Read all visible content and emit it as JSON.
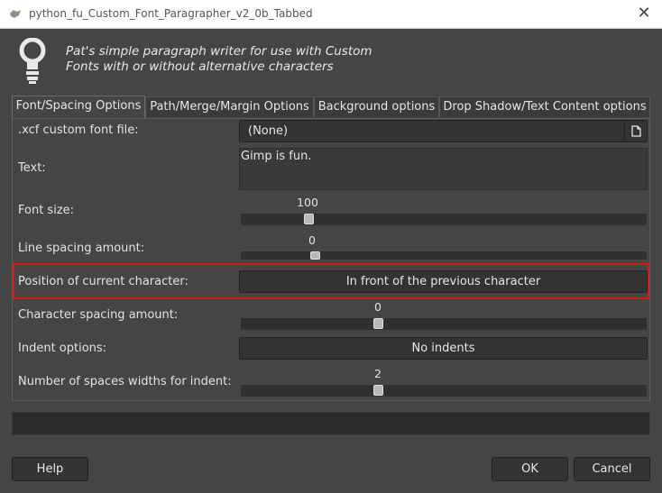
{
  "window": {
    "title": "python_fu_Custom_Font_Paragrapher_v2_0b_Tabbed"
  },
  "header": {
    "line1": "Pat's simple paragraph writer for use with Custom",
    "line2": "Fonts with or without alternative characters"
  },
  "tabs": [
    {
      "label": "Font/Spacing Options",
      "active": true
    },
    {
      "label": "Path/Merge/Margin Options",
      "active": false
    },
    {
      "label": "Background options",
      "active": false
    },
    {
      "label": "Drop Shadow/Text Content options",
      "active": false
    }
  ],
  "form": {
    "font_file": {
      "label": ".xcf custom font file:",
      "value": "(None)"
    },
    "text": {
      "label": "Text:",
      "value": "Gimp is fun."
    },
    "font_size": {
      "label": "Font size:",
      "value": "100",
      "fraction": 0.16
    },
    "line_spacing": {
      "label": "Line spacing amount:",
      "value": "0",
      "fraction": 0.175
    },
    "char_position": {
      "label": "Position of current character:",
      "value": "In front of the previous character"
    },
    "char_spacing": {
      "label": "Character spacing amount:",
      "value": "0",
      "fraction": 0.335
    },
    "indent_options": {
      "label": "Indent options:",
      "value": "No indents"
    },
    "indent_spaces": {
      "label": "Number of spaces widths for indent:",
      "value": "2",
      "fraction": 0.335
    }
  },
  "buttons": {
    "help": "Help",
    "ok": "OK",
    "cancel": "Cancel"
  },
  "colors": {
    "highlight": "#d11b1b",
    "background": "#454545"
  },
  "icons": {
    "app": "gimp-icon",
    "header": "lightbulb-icon",
    "file": "document-open-icon",
    "close": "close-icon"
  }
}
